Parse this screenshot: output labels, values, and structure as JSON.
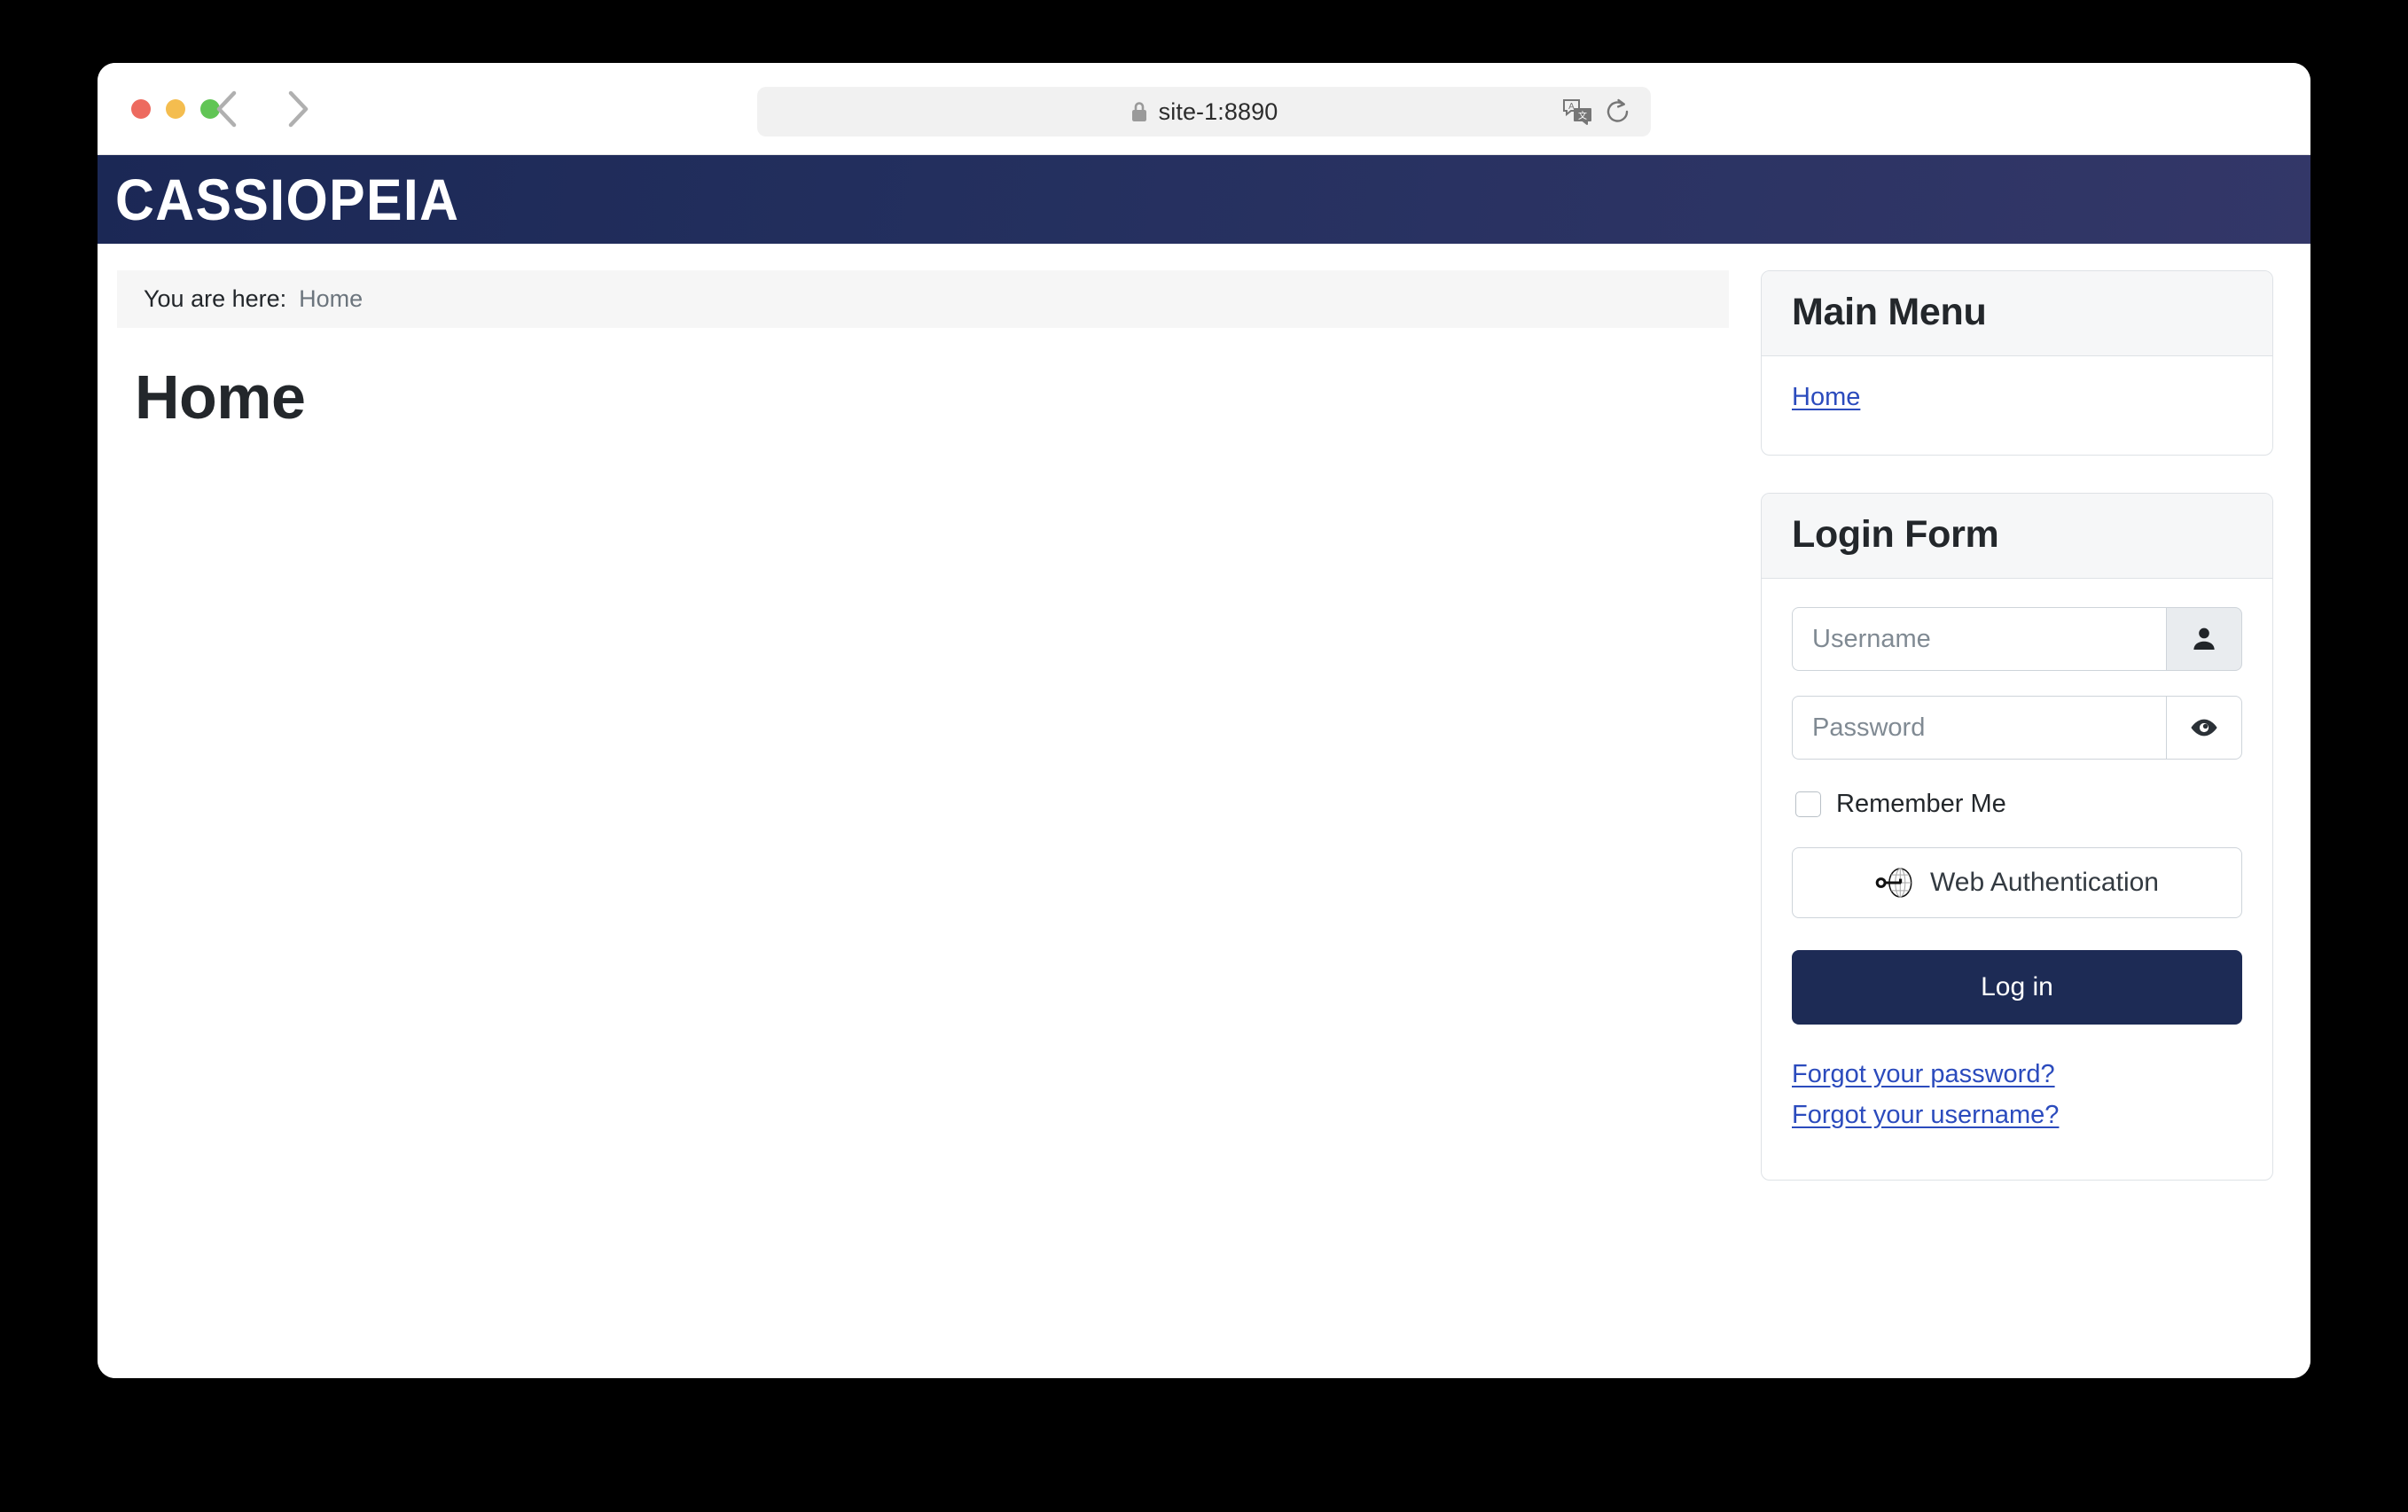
{
  "browser": {
    "traffic_lights": [
      "close",
      "minimize",
      "maximize"
    ],
    "back_label": "Back",
    "forward_label": "Forward",
    "url": "site-1:8890",
    "lock_icon": "lock-icon",
    "translate_icon": "translate-icon",
    "reload_icon": "reload-icon"
  },
  "site": {
    "brand": "CASSIOPEIA",
    "header_gradient_from": "#1b2855",
    "header_gradient_to": "#333768"
  },
  "breadcrumb": {
    "label": "You are here:",
    "current": "Home"
  },
  "main": {
    "page_title": "Home"
  },
  "sidebar": {
    "main_menu": {
      "title": "Main Menu",
      "items": [
        {
          "label": "Home"
        }
      ]
    },
    "login_form": {
      "title": "Login Form",
      "username_placeholder": "Username",
      "username_value": "",
      "username_icon": "user-icon",
      "password_placeholder": "Password",
      "password_value": "",
      "password_icon": "eye-icon",
      "remember_label": "Remember Me",
      "remember_checked": false,
      "webauthn_label": "Web Authentication",
      "webauthn_icon": "webauthn-key-globe-icon",
      "login_label": "Log in",
      "login_button_color": "#1d2b55",
      "links": [
        {
          "label": "Forgot your password?"
        },
        {
          "label": "Forgot your username?"
        }
      ],
      "link_color": "#2b4bbd"
    }
  }
}
